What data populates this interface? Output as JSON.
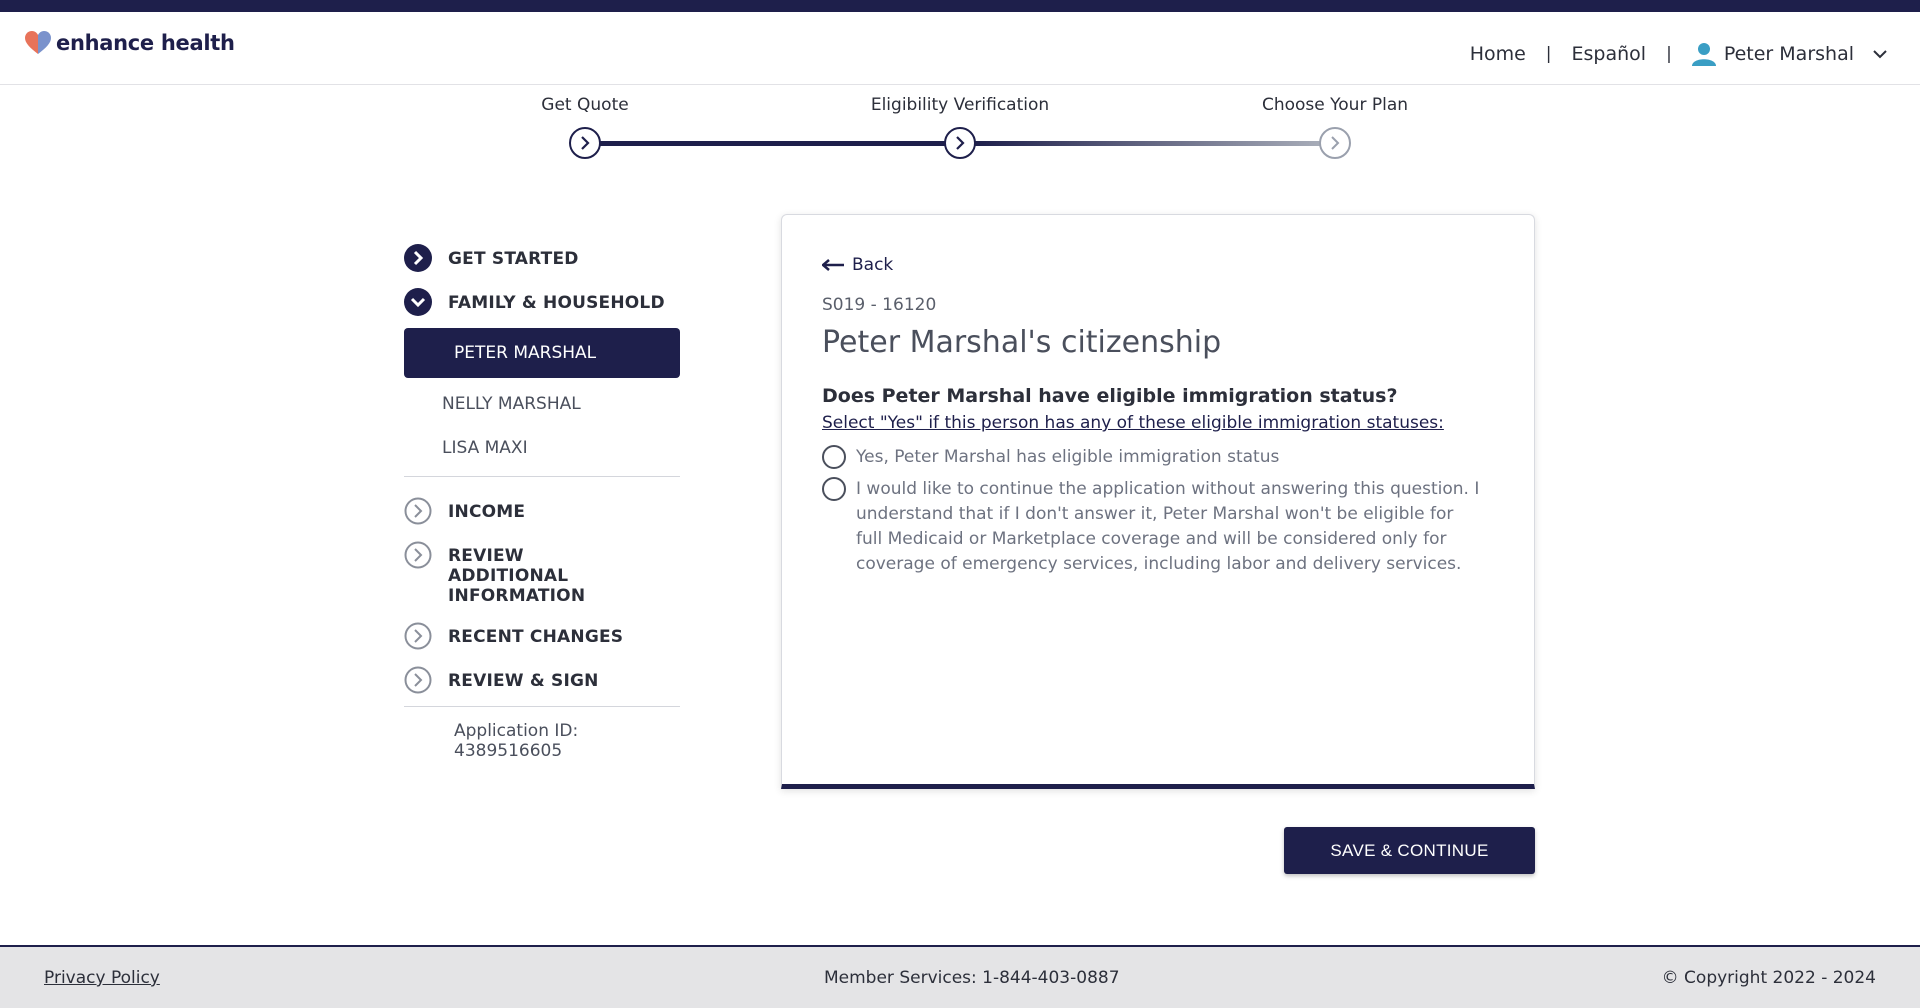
{
  "header": {
    "logo_text": "enhance health",
    "nav": {
      "home": "Home",
      "language": "Español",
      "user_name": "Peter Marshal"
    }
  },
  "progress": {
    "steps": [
      {
        "label": "Get Quote",
        "state": "complete"
      },
      {
        "label": "Eligibility Verification",
        "state": "current"
      },
      {
        "label": "Choose Your Plan",
        "state": "upcoming"
      }
    ]
  },
  "sidebar": {
    "sections": [
      {
        "label": "GET STARTED",
        "icon": "chevron-right-filled-icon"
      },
      {
        "label": "FAMILY & HOUSEHOLD",
        "icon": "chevron-down-filled-icon"
      },
      {
        "label": "INCOME",
        "icon": "chevron-right-outline-icon"
      },
      {
        "label": "REVIEW ADDITIONAL INFORMATION",
        "icon": "chevron-right-outline-icon"
      },
      {
        "label": "RECENT CHANGES",
        "icon": "chevron-right-outline-icon"
      },
      {
        "label": "REVIEW & SIGN",
        "icon": "chevron-right-outline-icon"
      }
    ],
    "members": [
      "PETER MARSHAL",
      "NELLY MARSHAL",
      "LISA MAXI"
    ],
    "application_id": "Application ID: 4389516605"
  },
  "card": {
    "back_label": "Back",
    "code": "S019 - 16120",
    "title": "Peter Marshal's citizenship",
    "question": "Does Peter Marshal have eligible immigration status?",
    "helper_link": "Select \"Yes\" if this person has any of these eligible immigration statuses:",
    "options": [
      "Yes, Peter Marshal has eligible immigration status",
      "I would like to continue the application without answering this question. I understand that if I don't answer it, Peter Marshal won't be eligible for full Medicaid or Marketplace coverage and will be considered only for coverage of emergency services, including labor and delivery services."
    ]
  },
  "actions": {
    "save_continue": "SAVE & CONTINUE"
  },
  "footer": {
    "privacy": "Privacy Policy",
    "member_services": "Member Services: 1-844-403-0887",
    "copyright": "© Copyright 2022 - 2024"
  },
  "colors": {
    "brand_navy": "#1e1f4b",
    "logo_heart_left": "#e8735a",
    "logo_heart_right": "#6b86c6",
    "user_icon": "#3a9ec4"
  }
}
